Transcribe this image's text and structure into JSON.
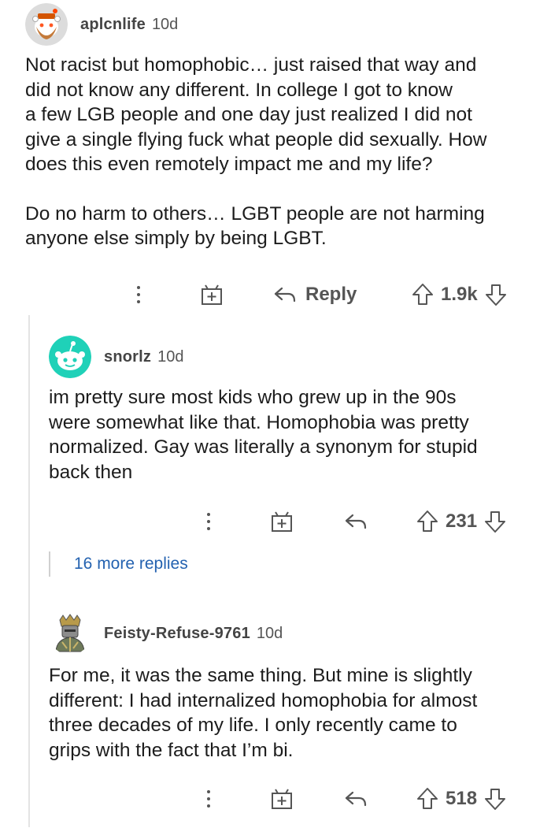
{
  "comments": [
    {
      "username": "aplcnlife",
      "age": "10d",
      "paragraphs": [
        "Not racist but homophobic… just raised that way and\ndid not know any different. In college I got to know\na few LGB people and one day just realized I did not\ngive a single flying fuck what people did sexually. How\ndoes this even remotely impact me and my life?",
        "Do no harm to others… LGBT people are not harming\nanyone else simply by being LGBT."
      ],
      "reply_label": "Reply",
      "votes": "1.9k"
    },
    {
      "username": "snorlz",
      "age": "10d",
      "paragraphs": [
        "im pretty sure most kids who grew up in the 90s\nwere somewhat like that. Homophobia was pretty\nnormalized. Gay was literally a synonym for stupid\nback then"
      ],
      "votes": "231",
      "more_replies": "16 more replies"
    },
    {
      "username": "Feisty-Refuse-9761",
      "age": "10d",
      "paragraphs": [
        "For me, it was the same thing. But mine is slightly\ndifferent: I had internalized homophobia for almost\nthree decades of my life. I only recently came to\ngrips with the fact that I’m bi."
      ],
      "votes": "518"
    }
  ],
  "colors": {
    "text": "#1c1c1c",
    "meta": "#555555",
    "link": "#2462b0",
    "teal_avatar": "#1fd1b8"
  },
  "icons": [
    "more-options-icon",
    "award-icon",
    "reply-icon",
    "upvote-icon",
    "downvote-icon"
  ]
}
